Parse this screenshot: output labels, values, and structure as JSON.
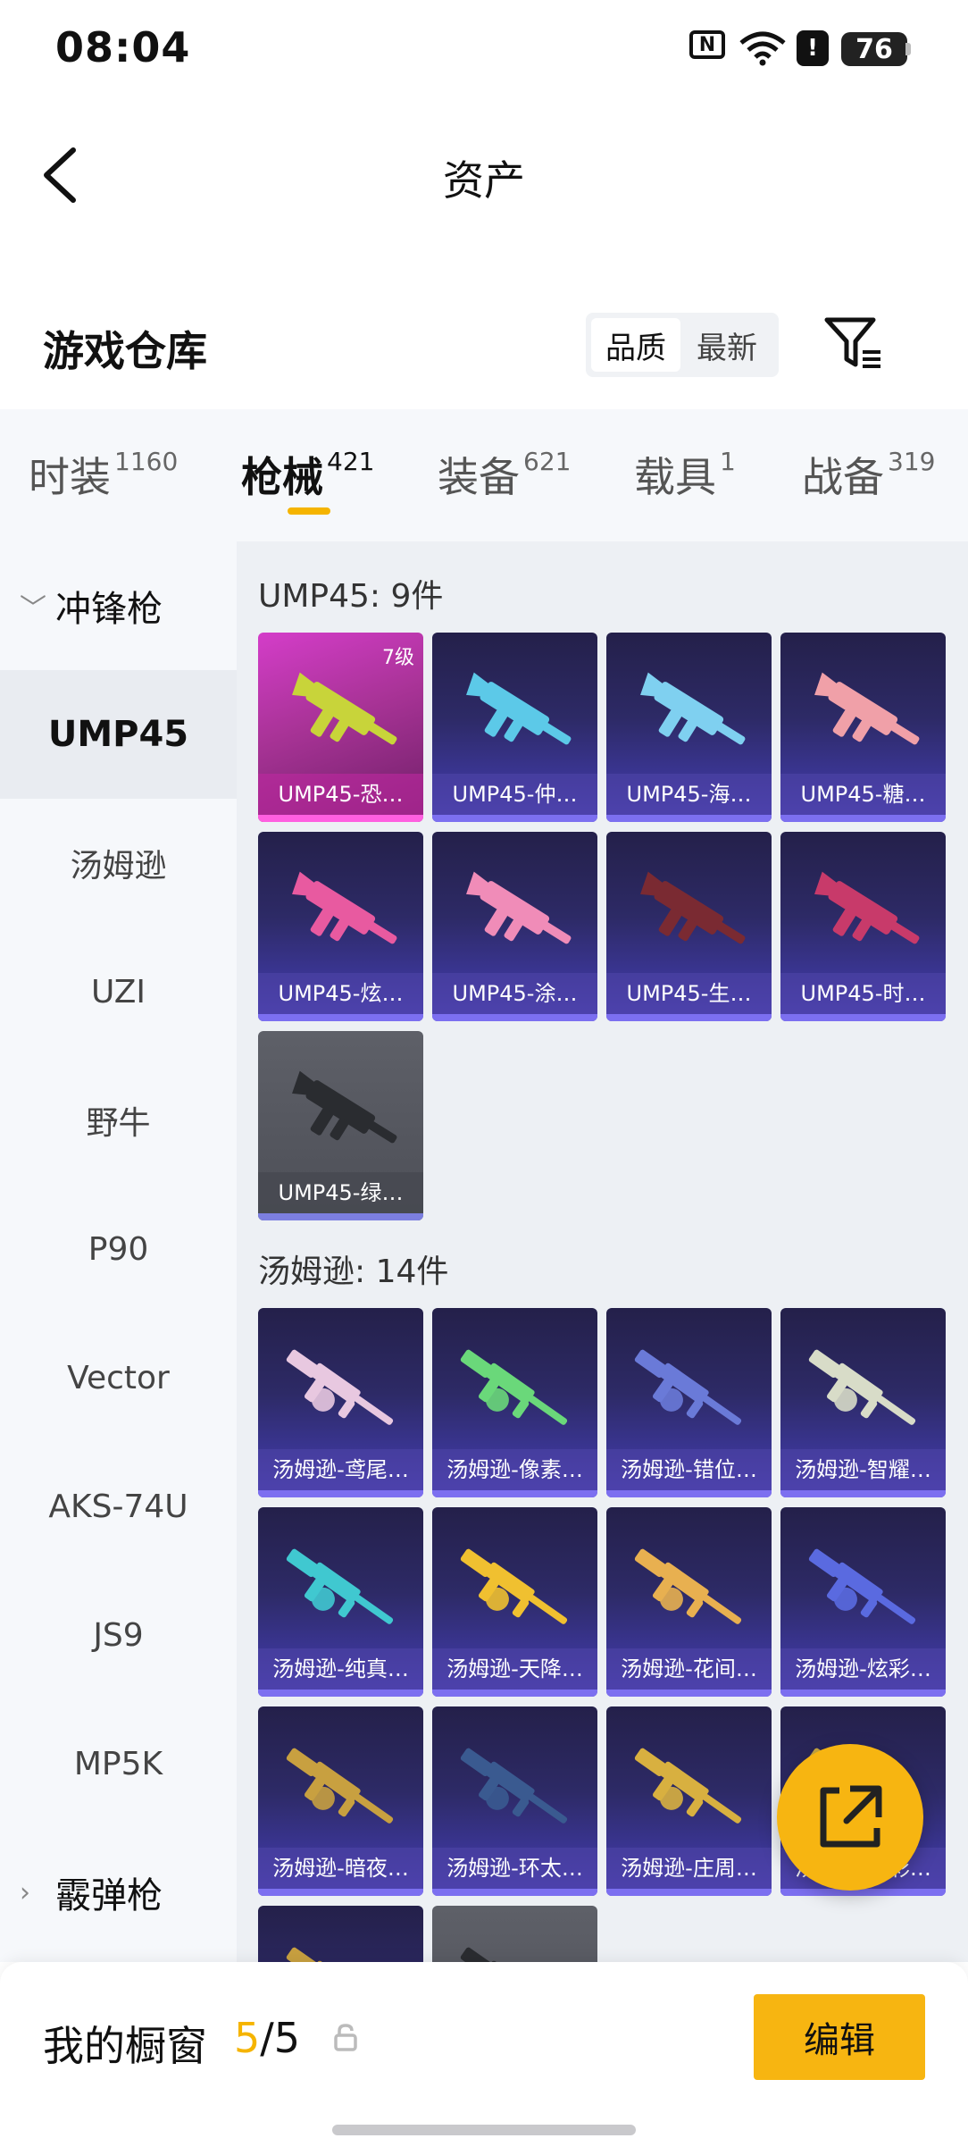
{
  "status_bar": {
    "time": "08:04",
    "battery": "76",
    "nfc": "N",
    "alert": "!"
  },
  "nav": {
    "title": "资产"
  },
  "warehouse": {
    "title": "游戏仓库",
    "sort_quality": "品质",
    "sort_newest": "最新"
  },
  "tabs": [
    {
      "label": "时装",
      "count": "1160"
    },
    {
      "label": "枪械",
      "count": "421"
    },
    {
      "label": "装备",
      "count": "621"
    },
    {
      "label": "载具",
      "count": "1"
    },
    {
      "label": "战备",
      "count": "319"
    }
  ],
  "sidebar": {
    "group_smg": "冲锋枪",
    "items": [
      "UMP45",
      "汤姆逊",
      "UZI",
      "野牛",
      "P90",
      "Vector",
      "AKS-74U",
      "JS9",
      "MP5K"
    ],
    "group_shotgun": "霰弹枪"
  },
  "sections": [
    {
      "title": "UMP45: 9件",
      "cards": [
        {
          "name": "UMP45-恐…",
          "level": "7级",
          "style": "pink",
          "gun": "#c8d43a"
        },
        {
          "name": "UMP45-仲…",
          "style": "purple",
          "gun": "#5cc9e8"
        },
        {
          "name": "UMP45-海…",
          "style": "purple",
          "gun": "#7fd0f0"
        },
        {
          "name": "UMP45-糖…",
          "style": "purple",
          "gun": "#f0a0a8"
        },
        {
          "name": "UMP45-炫…",
          "style": "purple",
          "gun": "#e85aa0"
        },
        {
          "name": "UMP45-涂…",
          "style": "purple",
          "gun": "#f08cb8"
        },
        {
          "name": "UMP45-生…",
          "style": "purple",
          "gun": "#7a2a32"
        },
        {
          "name": "UMP45-时…",
          "style": "purple",
          "gun": "#c83a6a"
        },
        {
          "name": "UMP45-绿…",
          "style": "gray",
          "gun": "#2a2c30"
        }
      ]
    },
    {
      "title": "汤姆逊: 14件",
      "cards": [
        {
          "name": "汤姆逊-鸢尾…",
          "style": "purple",
          "gun": "#e8c8e0"
        },
        {
          "name": "汤姆逊-像素…",
          "style": "purple",
          "gun": "#6ad87a"
        },
        {
          "name": "汤姆逊-错位…",
          "style": "purple",
          "gun": "#6a7ad8"
        },
        {
          "name": "汤姆逊-智耀…",
          "style": "purple",
          "gun": "#d8dcc8"
        },
        {
          "name": "汤姆逊-纯真…",
          "style": "purple",
          "gun": "#40c8d0"
        },
        {
          "name": "汤姆逊-天降…",
          "style": "purple",
          "gun": "#f0c030"
        },
        {
          "name": "汤姆逊-花间…",
          "style": "purple",
          "gun": "#e8b050"
        },
        {
          "name": "汤姆逊-炫彩…",
          "style": "purple",
          "gun": "#5a6ae0"
        },
        {
          "name": "汤姆逊-暗夜…",
          "style": "purple",
          "gun": "#c8a040"
        },
        {
          "name": "汤姆逊-环太…",
          "style": "purple",
          "gun": "#3a5a90"
        },
        {
          "name": "汤姆逊-庄周…",
          "style": "purple",
          "gun": "#d8b040"
        },
        {
          "name": "汤姆逊-…彩…",
          "style": "purple",
          "gun": "#c8a840"
        },
        {
          "name": "",
          "style": "purple",
          "gun": "#c8a040"
        },
        {
          "name": "",
          "style": "gray",
          "gun": "#2a2c30"
        }
      ]
    }
  ],
  "showcase": {
    "label": "我的橱窗",
    "used": "5",
    "total": "/5"
  },
  "edit_button": "编辑",
  "colors": {
    "accent": "#f7b511",
    "tab_indicator": "#f5b400"
  }
}
